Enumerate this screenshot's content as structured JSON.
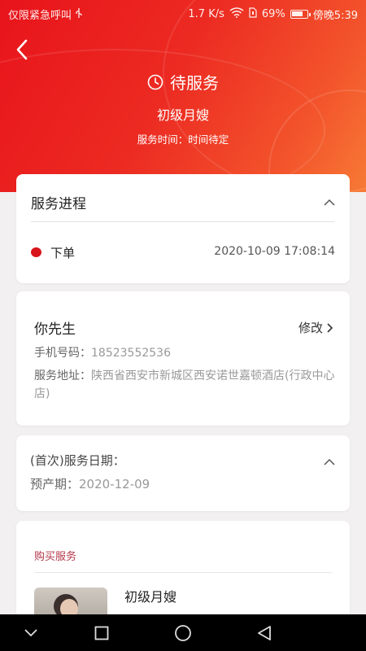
{
  "status_bar": {
    "carrier": "仅限紧急呼叫",
    "usb_icon": "usb-icon",
    "speed": "1.7 K/s",
    "battery_percent": "69%",
    "time": "傍晚5:39"
  },
  "header": {
    "back_icon": "chevron-left-icon",
    "status_icon": "clock-icon",
    "status": "待服务",
    "service_name": "初级月嫂",
    "service_time": "服务时间：时间待定"
  },
  "progress": {
    "title": "服务进程",
    "steps": [
      {
        "label": "下单",
        "time": "2020-10-09 17:08:14"
      }
    ]
  },
  "contact": {
    "name": "你先生",
    "edit_label": "修改",
    "phone_label": "手机号码：",
    "phone": "18523552536",
    "address_label": "服务地址：",
    "address": "陕西省西安市新城区西安诺世嘉顿酒店(行政中心店)"
  },
  "schedule": {
    "first_date_label": "(首次)服务日期：",
    "due_label": "预产期：",
    "due_date": "2020-12-09"
  },
  "purchase": {
    "title": "购买服务",
    "product_name": "初级月嫂"
  },
  "colors": {
    "accent": "#e8141b",
    "dot": "#d9151c",
    "purchase_title": "#b3384a"
  },
  "nav": [
    "chevron-down-icon",
    "square-icon",
    "circle-icon",
    "triangle-back-icon"
  ]
}
